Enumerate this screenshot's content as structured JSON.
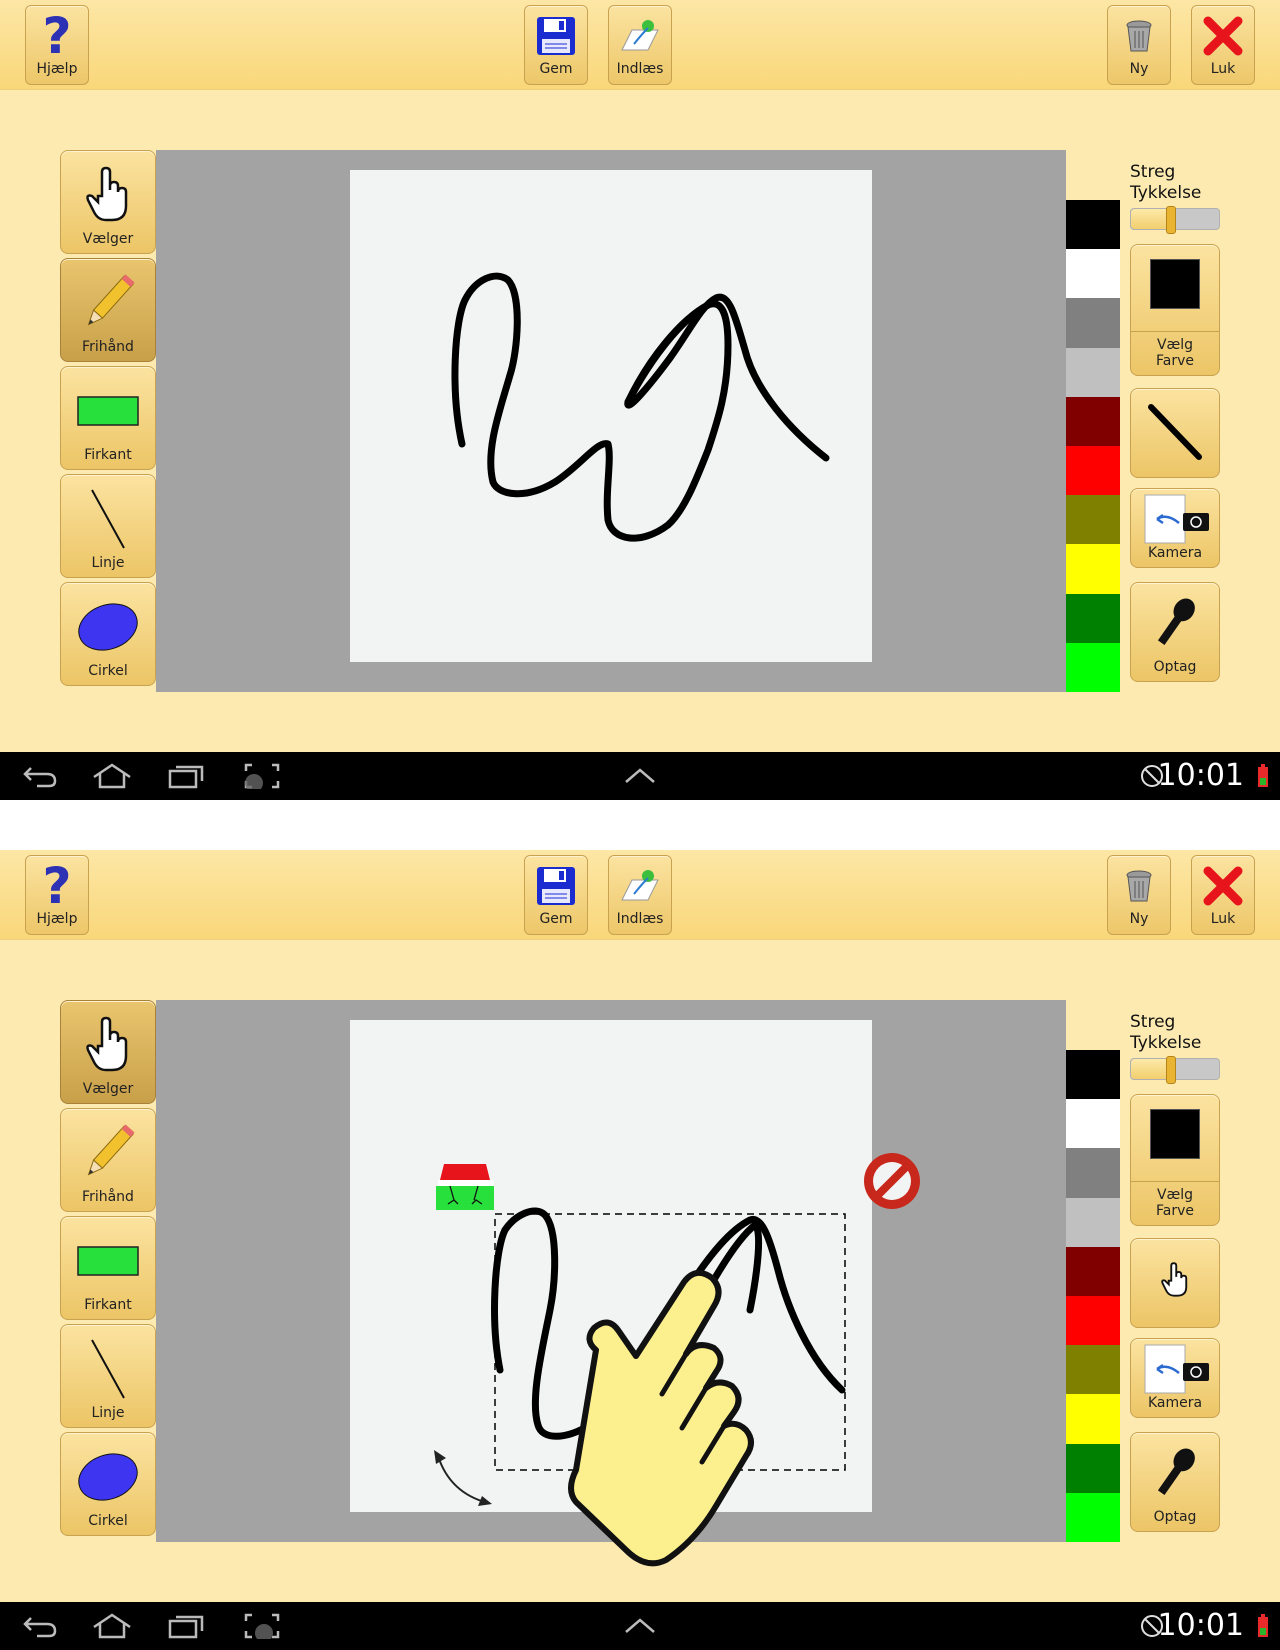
{
  "toolbar": {
    "help_label": "Hjælp",
    "save_label": "Gem",
    "load_label": "Indlæs",
    "new_label": "Ny",
    "close_label": "Luk"
  },
  "tools": {
    "select_label": "Vælger",
    "freehand_label": "Frihånd",
    "rect_label": "Firkant",
    "line_label": "Linje",
    "circle_label": "Cirkel"
  },
  "stroke": {
    "label_line1": "Streg",
    "label_line2": "Tykkelse",
    "thickness_fraction": 0.45
  },
  "right_panel": {
    "color_label_line1": "Vælg",
    "color_label_line2": "Farve",
    "selected_color": "#000000",
    "camera_label": "Kamera",
    "record_label": "Optag"
  },
  "palette": [
    "#000000",
    "#ffffff",
    "#808080",
    "#c0c0c0",
    "#800000",
    "#ff0000",
    "#808000",
    "#ffff00",
    "#008000",
    "#00ff00"
  ],
  "status": {
    "time": "10:01"
  },
  "screens": [
    {
      "active_tool": "freehand",
      "mode": "draw"
    },
    {
      "active_tool": "select",
      "mode": "select"
    }
  ]
}
